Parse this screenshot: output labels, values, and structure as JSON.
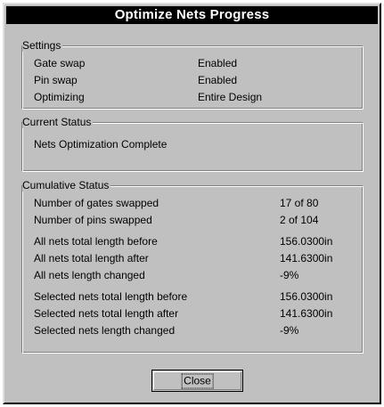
{
  "window": {
    "title": "Optimize Nets Progress"
  },
  "settings": {
    "label": "Settings",
    "rows": [
      {
        "label": "Gate swap",
        "value": "Enabled"
      },
      {
        "label": "Pin swap",
        "value": "Enabled"
      },
      {
        "label": "Optimizing",
        "value": "Entire Design"
      }
    ]
  },
  "current_status": {
    "label": "Current Status",
    "message": "Nets Optimization Complete"
  },
  "cumulative_status": {
    "label": "Cumulative Status",
    "rows": [
      {
        "label": "Number of gates swapped",
        "value": "17 of 80"
      },
      {
        "label": "Number of pins swapped",
        "value": "2 of 104"
      },
      {
        "label": "All nets total length before",
        "value": "156.0300in"
      },
      {
        "label": "All nets total length after",
        "value": "141.6300in"
      },
      {
        "label": "All nets length changed",
        "value": "-9%"
      },
      {
        "label": "Selected nets total length before",
        "value": "156.0300in"
      },
      {
        "label": "Selected nets total length after",
        "value": "141.6300in"
      },
      {
        "label": "Selected nets length changed",
        "value": "-9%"
      }
    ]
  },
  "buttons": {
    "close_label": "Close"
  }
}
